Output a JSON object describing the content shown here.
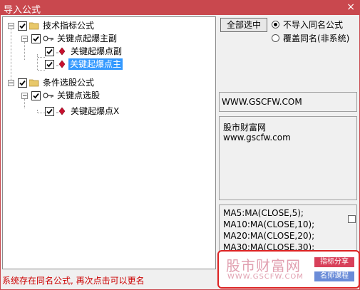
{
  "window": {
    "title": "导入公式",
    "close_glyph": "×"
  },
  "tree": {
    "nodes": [
      {
        "label": "技术指标公式",
        "type": "folder"
      },
      {
        "label": "关键点起爆主副",
        "type": "key"
      },
      {
        "label": "关键起爆点副",
        "type": "formula"
      },
      {
        "label": "关键起爆点主",
        "type": "formula",
        "selected": true
      },
      {
        "label": "条件选股公式",
        "type": "folder"
      },
      {
        "label": "关键点选股",
        "type": "key"
      },
      {
        "label": "关键起爆点X",
        "type": "formula"
      }
    ],
    "expander_glyph": "−"
  },
  "buttons": {
    "select_all": "全部选中"
  },
  "options": {
    "no_import_same_name": "不导入同名公式",
    "overwrite_same_name": "覆盖同名(非系统)",
    "selected": "no_import_same_name"
  },
  "url_box": "WWW.GSCFW.COM",
  "description": {
    "line1": "股市财富网",
    "line2": "www.gscfw.com"
  },
  "code_lines": [
    "MA5:MA(CLOSE,5);",
    "MA10:MA(CLOSE,10);",
    "MA20:MA(CLOSE,20);",
    "MA30:MA(CLOSE,30);"
  ],
  "watermark": {
    "name_cn": "股市财富网",
    "url": "WWW.GSCFW.COM",
    "tag1": "指标分享",
    "tag2": "名师课程",
    "tag1_color": "#d8405a",
    "tag2_color": "#6a8cd8"
  },
  "status_text": "系统存在同名公式, 再次点击可以更名",
  "colors": {
    "titlebar": "#c9484e",
    "selection": "#3399ff",
    "status": "#cc0000"
  }
}
